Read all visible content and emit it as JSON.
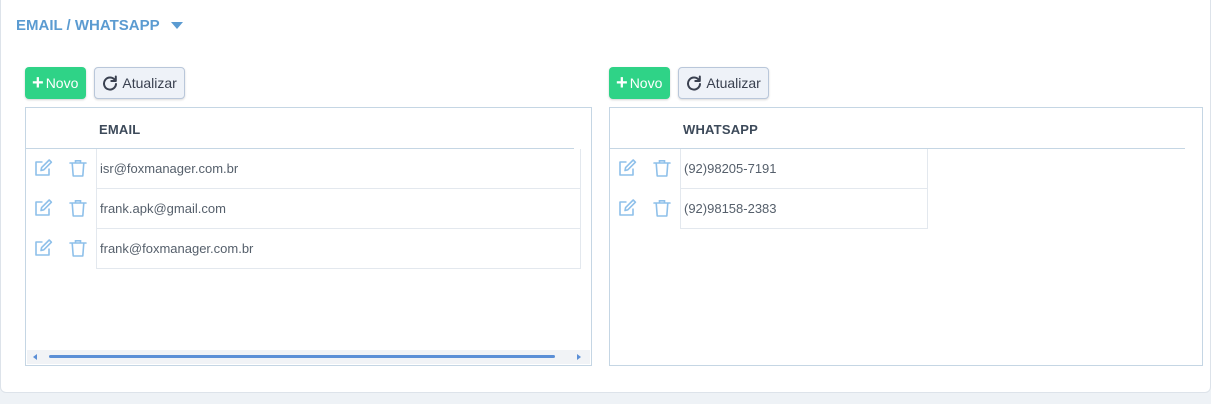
{
  "section": {
    "title": "EMAIL / WHATSAPP",
    "caret_icon": "caret-down-icon"
  },
  "email_panel": {
    "new_label": "Novo",
    "refresh_label": "Atualizar",
    "column_header": "EMAIL",
    "rows": [
      {
        "value": "isr@foxmanager.com.br"
      },
      {
        "value": "frank.apk@gmail.com"
      },
      {
        "value": "frank@foxmanager.com.br"
      }
    ]
  },
  "whatsapp_panel": {
    "new_label": "Novo",
    "refresh_label": "Atualizar",
    "column_header": "WHATSAPP",
    "rows": [
      {
        "value": "(92)98205-7191"
      },
      {
        "value": "(92)98158-2383"
      }
    ]
  },
  "colors": {
    "accent": "#5b9bd1",
    "new_button": "#2fd387",
    "action_icon": "#8ec0ea"
  }
}
